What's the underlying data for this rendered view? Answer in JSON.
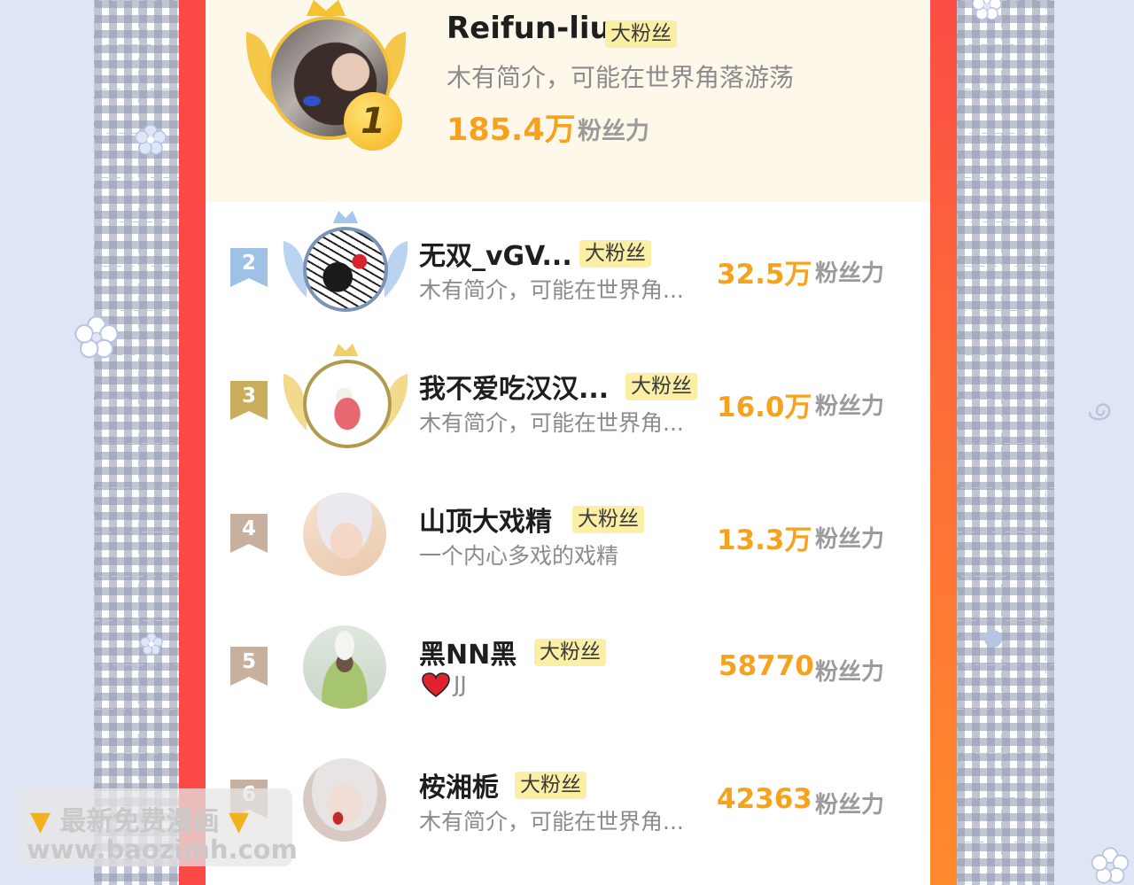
{
  "top": {
    "rank": "1",
    "name": "Reifun-liu",
    "badge": "大粉丝",
    "intro": "木有简介，可能在世界角落游荡",
    "score": "185.4万",
    "unit": "粉丝力"
  },
  "rows": [
    {
      "rank": "2",
      "name": "无双_vGV...",
      "badge": "大粉丝",
      "intro": "木有简介，可能在世界角...",
      "score": "32.5万",
      "unit": "粉丝力"
    },
    {
      "rank": "3",
      "name": "我不爱吃汉汉...",
      "badge": "大粉丝",
      "intro": "木有简介，可能在世界角...",
      "score": "16.0万",
      "unit": "粉丝力"
    },
    {
      "rank": "4",
      "name": "山顶大戏精",
      "badge": "大粉丝",
      "intro": "一个内心多戏的戏精",
      "score": "13.3万",
      "unit": "粉丝力"
    },
    {
      "rank": "5",
      "name": "黑NN黑",
      "badge": "大粉丝",
      "intro": "JJ",
      "score": "58770",
      "unit": "粉丝力"
    },
    {
      "rank": "6",
      "name": "桉湘栀",
      "badge": "大粉丝",
      "intro": "木有简介，可能在世界角...",
      "score": "42363",
      "unit": "粉丝力"
    }
  ],
  "watermark": {
    "line1": "最新免费漫画",
    "line2": "www.baozimh.com"
  },
  "colors": {
    "frame": "#fb4a46",
    "score": "#f7a21d",
    "badge_bg": "#fbeea5",
    "top_card_bg": "#fdf8ea"
  }
}
